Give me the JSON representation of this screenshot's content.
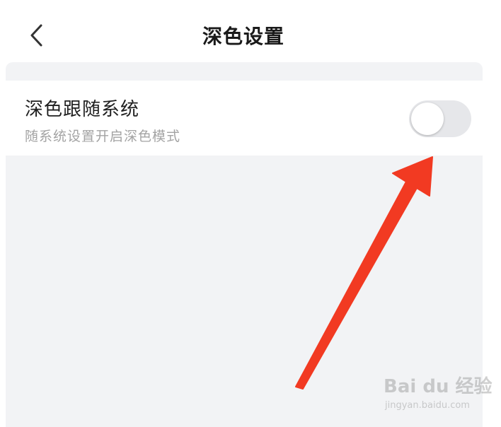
{
  "nav": {
    "title": "深色设置",
    "back_icon": "chevron-left-icon"
  },
  "setting": {
    "title": "深色跟随系统",
    "description": "随系统设置开启深色模式",
    "enabled": false
  },
  "annotation": {
    "color": "#f23a22",
    "icon": "arrow-icon"
  },
  "watermark": {
    "logo": "Bai du 经验",
    "url": "jingyan.baidu.com"
  },
  "colors": {
    "background": "#f2f3f5",
    "card": "#ffffff",
    "toggle_off": "#e6e7ea"
  }
}
